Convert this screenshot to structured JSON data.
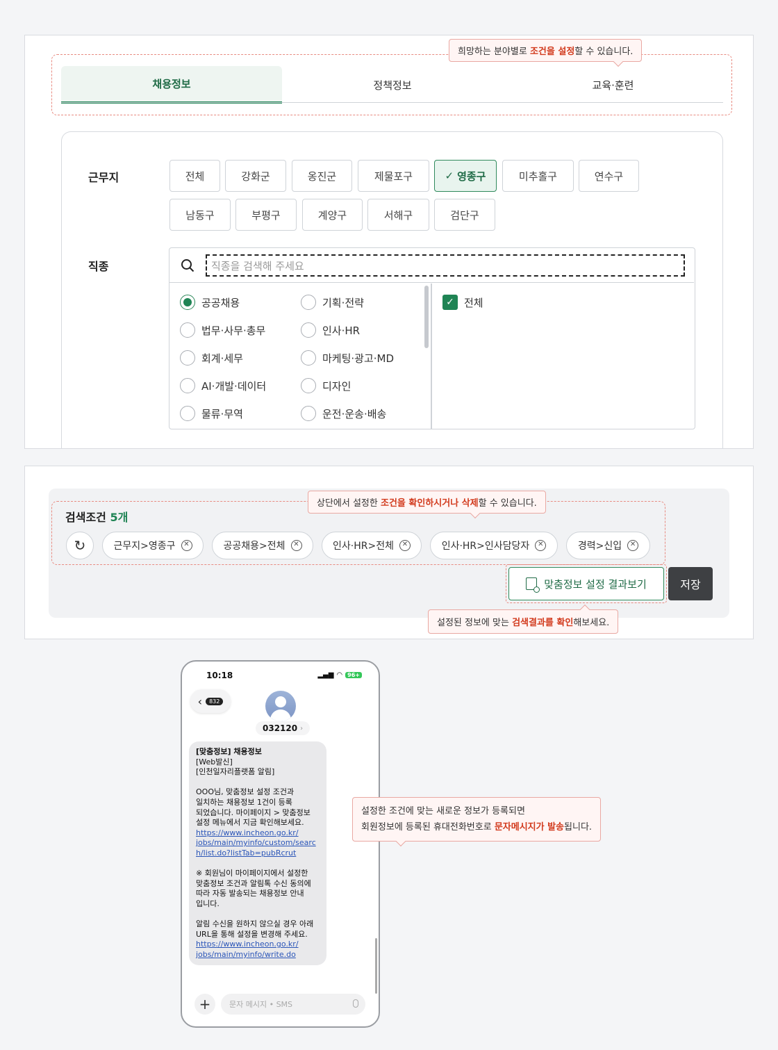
{
  "colors": {
    "accent": "#1f8454",
    "highlight": "#d23b1e",
    "dark_button": "#3e4043"
  },
  "top_callout": {
    "pre": "희망하는 분야별로 ",
    "em": "조건을 설정",
    "post": "할 수 있습니다."
  },
  "tabs": [
    {
      "label": "채용정보",
      "active": true
    },
    {
      "label": "정책정보",
      "active": false
    },
    {
      "label": "교육·훈련",
      "active": false
    }
  ],
  "workplace": {
    "label": "근무지",
    "options": [
      {
        "label": "전체"
      },
      {
        "label": "강화군"
      },
      {
        "label": "옹진군"
      },
      {
        "label": "제물포구"
      },
      {
        "label": "영종구",
        "selected": true
      },
      {
        "label": "미추홀구"
      },
      {
        "label": "연수구"
      },
      {
        "label": "남동구"
      },
      {
        "label": "부평구"
      },
      {
        "label": "계양구"
      },
      {
        "label": "서해구"
      },
      {
        "label": "검단구"
      }
    ]
  },
  "job": {
    "label": "직종",
    "search_placeholder": "직종을 검색해 주세요",
    "categories": [
      {
        "label": "공공채용",
        "checked": true
      },
      {
        "label": "기획·전략"
      },
      {
        "label": "법무·사무·총무"
      },
      {
        "label": "인사·HR"
      },
      {
        "label": "회계·세무"
      },
      {
        "label": "마케팅·광고·MD"
      },
      {
        "label": "AI·개발·데이터"
      },
      {
        "label": "디자인"
      },
      {
        "label": "물류·무역"
      },
      {
        "label": "운전·운송·배송"
      }
    ],
    "sub_options": [
      {
        "label": "전체",
        "checked": true
      }
    ]
  },
  "conditions": {
    "title": "검색조건",
    "count": "5개",
    "callout": {
      "pre": "상단에서 설정한 ",
      "em": "조건을 확인하시거나 삭제",
      "post": "할 수 있습니다."
    },
    "tags": [
      {
        "label": "근무지>영종구"
      },
      {
        "label": "공공채용>전체"
      },
      {
        "label": "인사·HR>전체"
      },
      {
        "label": "인사·HR>인사담당자"
      },
      {
        "label": "경력>신입"
      }
    ],
    "remove_glyph": "✕",
    "refresh_glyph": "↻",
    "result_button": "맞춤정보 설정 결과보기",
    "save_button": "저장",
    "result_callout": {
      "pre": "설정된 정보에 맞는 ",
      "em": "검색결과를 확인",
      "post": "해보세요."
    }
  },
  "phone": {
    "time": "10:18",
    "battery": "96+",
    "signal": "▂▄▆",
    "wifi": "◠",
    "back_glyph": "‹",
    "unread": "832",
    "sender": "032120",
    "sender_chevron": "›",
    "message": {
      "title": "[맞춤정보] 채용정보",
      "header_lines": "[Web발신]\n[인천일자리플랫폼 알림]",
      "body1": "OOO님, 맞춤정보 설정 조건과\n일치하는 채용정보 1건이 등록\n되었습니다. 마이페이지 > 맞춤정보\n설정 메뉴에서 지금 확인해보세요.",
      "link1": "https://www.incheon.go.kr/\njobs/main/myinfo/custom/searc\nh/list.do?listTab=pubRcrut",
      "body2": "※ 회원님이 마이페이지에서 설정한\n맞춤정보 조건과 알림톡 수신 동의에\n따라 자동 발송되는 채용정보 안내\n입니다.",
      "body3": "알림 수신을 원하지 않으실 경우 아래\nURL을 통해 설정을 변경해 주세요.",
      "link2": "https://www.incheon.go.kr/\njobs/main/myinfo/write.do"
    },
    "plus_glyph": "+",
    "input_placeholder": "문자 메시지 • SMS"
  },
  "sms_callout": {
    "line1": "설정한 조건에 맞는 새로운 정보가 등록되면",
    "line2_pre": "회원정보에 등록된 휴대전화번호로 ",
    "line2_em": "문자메시지가 발송",
    "line2_post": "됩니다."
  }
}
